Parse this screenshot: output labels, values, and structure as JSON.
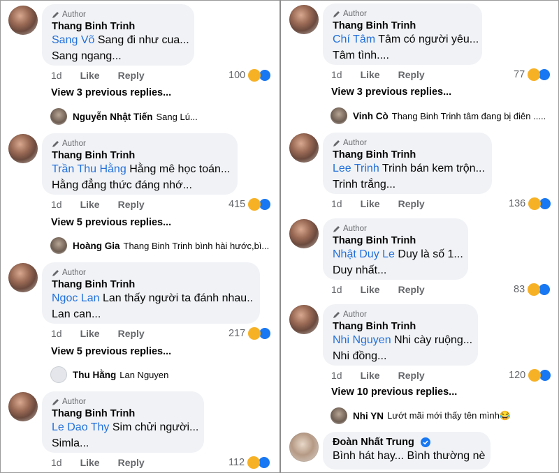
{
  "author_label": "Author",
  "time_label": "1d",
  "like_label": "Like",
  "reply_label": "Reply",
  "left": [
    {
      "name": "Thang Binh Trinh",
      "mention": "Sang Võ",
      "text1": "Sang đi như cua...",
      "text2": "Sang ngang...",
      "reactions": "100",
      "view_more": "View 3 previous replies...",
      "reply_name": "Nguyễn Nhật Tiến",
      "reply_text": "Sang Lú..."
    },
    {
      "name": "Thang Binh Trinh",
      "mention": "Trần Thu Hằng",
      "text1": "Hằng mê học toán...",
      "text2": "Hằng đẳng thức đáng nhớ...",
      "reactions": "415",
      "view_more": "View 5 previous replies...",
      "reply_name": "Hoàng Gia",
      "reply_text": "Thang Binh Trinh bình hài hước,bì..."
    },
    {
      "name": "Thang Binh Trinh",
      "mention": "Ngoc Lan",
      "text1": "Lan thấy người ta đánh nhau..",
      "text2": "Lan can...",
      "reactions": "217",
      "view_more": "View 5 previous replies...",
      "reply_name": "Thu Hằng",
      "reply_text": "Lan Nguyen"
    },
    {
      "name": "Thang Binh Trinh",
      "mention": "Le Dao Thy",
      "text1": "Sim chửi người...",
      "text2": "Simla...",
      "reactions": "112"
    }
  ],
  "right": [
    {
      "name": "Thang Binh Trinh",
      "mention": "Chí Tâm",
      "text1": "Tâm có người yêu...",
      "text2": "Tâm tình....",
      "reactions": "77",
      "view_more": "View 3 previous replies...",
      "reply_name": "Vinh Cò",
      "reply_text": "Thang Binh Trinh tâm đang bị điên ....."
    },
    {
      "name": "Thang Binh Trinh",
      "mention": "Lee Trinh",
      "text1": "Trinh bán kem trộn...",
      "text2": "Trinh trắng...",
      "reactions": "136"
    },
    {
      "name": "Thang Binh Trinh",
      "mention": "Nhật Duy Le",
      "text1": "Duy là số 1...",
      "text2": "Duy nhất...",
      "reactions": "83"
    },
    {
      "name": "Thang Binh Trinh",
      "mention": "Nhi Nguyen",
      "text1": "Nhi cày ruộng...",
      "text2": "Nhi đồng...",
      "reactions": "120",
      "view_more": "View 10 previous replies...",
      "reply_name": "Nhi YN",
      "reply_text": "Lướt mãi mới thấy tên mình😂"
    }
  ],
  "last": {
    "name": "Đoàn Nhất Trung",
    "text": "Bình hát hay... Bình thường nè"
  }
}
